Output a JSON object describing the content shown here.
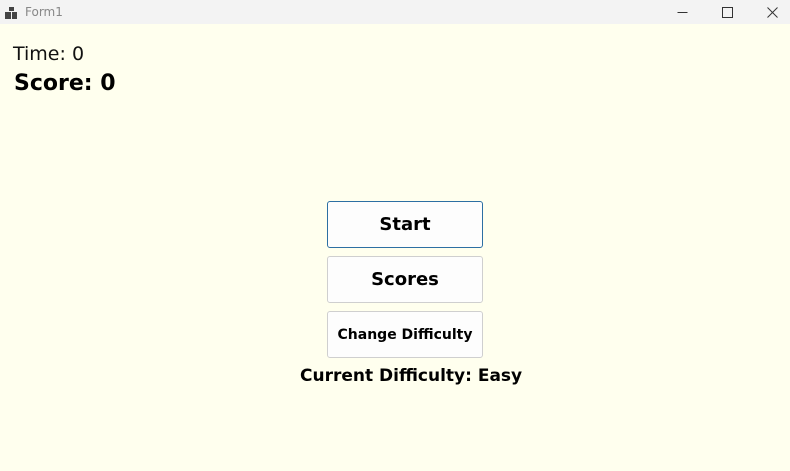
{
  "window": {
    "title": "Form1",
    "icon": "app-window-icon",
    "controls": {
      "minimize_icon": "minimize-icon",
      "maximize_icon": "maximize-icon",
      "close_icon": "close-icon"
    }
  },
  "status": {
    "time_text": "Time: 0",
    "score_text": "Score: 0"
  },
  "menu": {
    "start_label": "Start",
    "scores_label": "Scores",
    "change_difficulty_label": "Change Difficulty",
    "current_difficulty_text": "Current Difficulty: Easy"
  },
  "colors": {
    "background": "#FFFFEE",
    "titlebar": "#F3F3F3",
    "focus_border": "#2D6FA3"
  }
}
